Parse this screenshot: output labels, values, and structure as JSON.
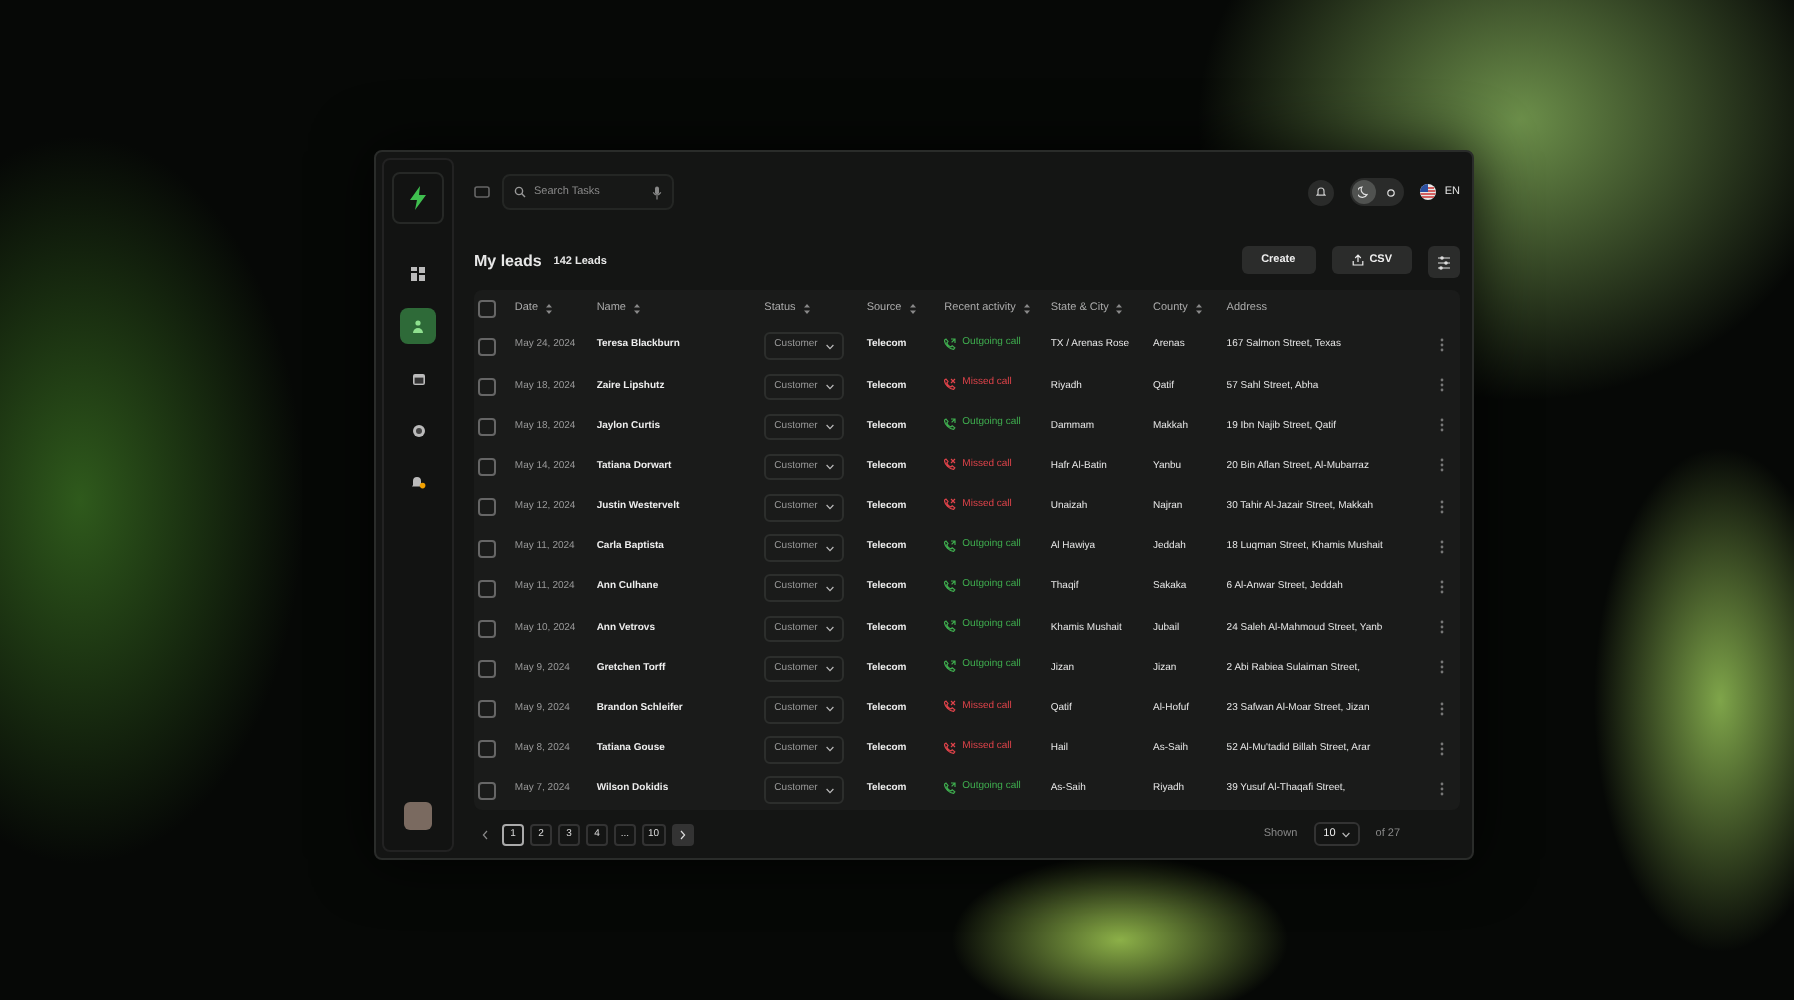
{
  "sidebar": {
    "items": [
      {
        "selected": false
      },
      {
        "selected": true
      },
      {
        "selected": false
      },
      {
        "selected": false
      },
      {
        "selected": false
      }
    ]
  },
  "topbar": {
    "search": {
      "placeholder": "Search Tasks"
    },
    "theme_toggle": {
      "dark": true
    },
    "language": "EN"
  },
  "header": {
    "title": "My leads",
    "count": "142 Leads",
    "buttons": [
      "Create",
      "CSV"
    ]
  },
  "table": {
    "columns": [
      {
        "label": "Date",
        "sortable": true
      },
      {
        "label": "Name",
        "sortable": true
      },
      {
        "label": "Status",
        "sortable": true
      },
      {
        "label": "Source",
        "sortable": true
      },
      {
        "label": "Recent activity",
        "sortable": true
      },
      {
        "label": "State & City",
        "sortable": true
      },
      {
        "label": "County",
        "sortable": true
      },
      {
        "label": "Address",
        "sortable": false
      }
    ],
    "all_checked": false,
    "rows": [
      {
        "checked": false,
        "date": "May 24, 2024",
        "name": "Teresa Blackburn",
        "status": "Customer",
        "source": "Telecom",
        "activity": {
          "kind": "outgoing",
          "label": "Outgoing call"
        },
        "state_city": "TX / Arenas Rose",
        "county": "Arenas",
        "address": "167 Salmon Street, Texas"
      },
      {
        "checked": false,
        "date": "May 18, 2024",
        "name": "Zaire Lipshutz",
        "status": "Customer",
        "source": "Telecom",
        "activity": {
          "kind": "missed",
          "label": "Missed call"
        },
        "state_city": "Riyadh",
        "county": "Qatif",
        "address": "57 Sahl Street, Abha"
      },
      {
        "checked": false,
        "date": "May 18, 2024",
        "name": "Jaylon Curtis",
        "status": "Customer",
        "source": "Telecom",
        "activity": {
          "kind": "outgoing",
          "label": "Outgoing call"
        },
        "state_city": "Dammam",
        "county": "Makkah",
        "address": "19 Ibn Najib Street, Qatif"
      },
      {
        "checked": false,
        "date": "May 14, 2024",
        "name": "Tatiana Dorwart",
        "status": "Customer",
        "source": "Telecom",
        "activity": {
          "kind": "missed",
          "label": "Missed call"
        },
        "state_city": "Hafr Al-Batin",
        "county": "Yanbu",
        "address": "20 Bin Aflan Street, Al-Mubarraz"
      },
      {
        "checked": false,
        "date": "May 12, 2024",
        "name": "Justin Westervelt",
        "status": "Customer",
        "source": "Telecom",
        "activity": {
          "kind": "missed",
          "label": "Missed call"
        },
        "state_city": "Unaizah",
        "county": "Najran",
        "address": "30 Tahir Al-Jazair Street, Makkah"
      },
      {
        "checked": false,
        "date": "May 11, 2024",
        "name": "Carla Baptista",
        "status": "Customer",
        "source": "Telecom",
        "activity": {
          "kind": "outgoing",
          "label": "Outgoing call"
        },
        "state_city": "Al Hawiya",
        "county": "Jeddah",
        "address": "18 Luqman Street, Khamis Mushait"
      },
      {
        "checked": false,
        "date": "May 11, 2024",
        "name": "Ann Culhane",
        "status": "Customer",
        "source": "Telecom",
        "activity": {
          "kind": "outgoing",
          "label": "Outgoing call"
        },
        "state_city": "Thaqif",
        "county": "Sakaka",
        "address": "6 Al-Anwar Street, Jeddah"
      },
      {
        "checked": false,
        "date": "May 10, 2024",
        "name": "Ann Vetrovs",
        "status": "Customer",
        "source": "Telecom",
        "activity": {
          "kind": "outgoing",
          "label": "Outgoing call"
        },
        "state_city": "Khamis Mushait",
        "county": "Jubail",
        "address": "24 Saleh Al-Mahmoud Street, Yanb"
      },
      {
        "checked": false,
        "date": "May 9, 2024",
        "name": "Gretchen Torff",
        "status": "Customer",
        "source": "Telecom",
        "activity": {
          "kind": "outgoing",
          "label": "Outgoing call"
        },
        "state_city": "Jizan",
        "county": "Jizan",
        "address": "2 Abi Rabiea Sulaiman Street,"
      },
      {
        "checked": false,
        "date": "May 9, 2024",
        "name": "Brandon Schleifer",
        "status": "Customer",
        "source": "Telecom",
        "activity": {
          "kind": "missed",
          "label": "Missed call"
        },
        "state_city": "Qatif",
        "county": "Al-Hofuf",
        "address": "23 Safwan Al-Moar Street, Jizan"
      },
      {
        "checked": false,
        "date": "May 8, 2024",
        "name": "Tatiana Gouse",
        "status": "Customer",
        "source": "Telecom",
        "activity": {
          "kind": "missed",
          "label": "Missed call"
        },
        "state_city": "Hail",
        "county": "As-Saih",
        "address": "52 Al-Mu'tadid Billah Street, Arar"
      },
      {
        "checked": false,
        "date": "May 7, 2024",
        "name": "Wilson Dokidis",
        "status": "Customer",
        "source": "Telecom",
        "activity": {
          "kind": "outgoing",
          "label": "Outgoing call"
        },
        "state_city": "As-Saih",
        "county": "Riyadh",
        "address": "39 Yusuf Al-Thaqafi Street,"
      }
    ]
  },
  "pagination": {
    "pages": [
      {
        "label": "1",
        "selected": true
      },
      {
        "label": "2",
        "selected": false
      },
      {
        "label": "3",
        "selected": false
      },
      {
        "label": "4",
        "selected": false
      },
      {
        "label": "...",
        "selected": false
      },
      {
        "label": "10",
        "selected": false
      }
    ],
    "shown_label": "Shown",
    "page_size": "10",
    "total": "of 27"
  }
}
